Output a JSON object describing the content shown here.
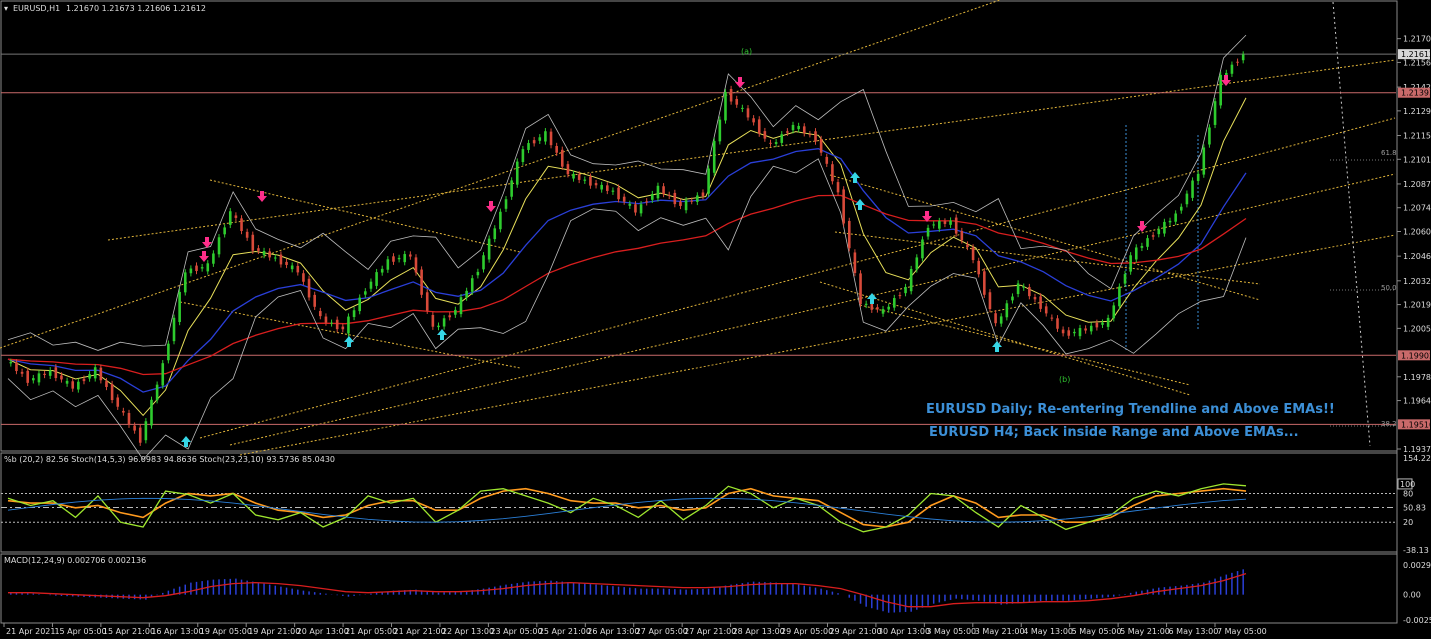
{
  "header": {
    "symbol": "EURUSD,H1",
    "ohlc": "1.21670 1.21673 1.21606 1.21612"
  },
  "annotations": {
    "daily": "EURUSD Daily; Re-entering Trendline and Above EMAs!!",
    "h4": "EURUSD H4; Back inside Range and Above EMAs...",
    "wave_a": "(a)",
    "wave_b": "(b)",
    "fib_618": "61.8",
    "fib_500": "50.0",
    "fib_382": "38.2"
  },
  "colors": {
    "background": "#000000",
    "bull_candle": "#2ecc2e",
    "bear_candle": "#d84a3a",
    "ema_fast": "#e8e05a",
    "ema_mid": "#2a3fd8",
    "ema_slow": "#d81e1e",
    "bollinger": "#bdbdbd",
    "trend_lines": "#e0b43a",
    "sell_arrow": "#ff2e8a",
    "buy_arrow": "#36d6e6",
    "stoch_fast": "#9ee62e",
    "stoch_slow": "#ff9a1e",
    "macd_hist": "#2a3fd8",
    "macd_signal": "#d81e1e",
    "annotation_text": "#3c8fd6"
  },
  "chart_data": [
    {
      "type": "line",
      "name": "price-panel",
      "y_axis_ticks": [
        "1.21700",
        "1.21565",
        "1.21425",
        "1.21290",
        "1.21150",
        "1.21015",
        "1.20875",
        "1.20740",
        "1.20605",
        "1.20465",
        "1.20325",
        "1.20190",
        "1.20055",
        "1.19780",
        "1.19645",
        "1.19370"
      ],
      "ylim": [
        1.1937,
        1.2184
      ],
      "price_labels": [
        {
          "text": "1.21612",
          "value": 1.21612
        },
        {
          "text": "1.21393",
          "value": 1.21393
        },
        {
          "text": "1.19902",
          "value": 1.19902
        },
        {
          "text": "1.19510",
          "value": 1.1951
        }
      ],
      "horizontal_levels": [
        1.21393,
        1.19902,
        1.1951
      ],
      "x_labels": [
        "21 Apr 2021",
        "15 Apr 05:00",
        "15 Apr 21:00",
        "16 Apr 13:00",
        "19 Apr 05:00",
        "19 Apr 21:00",
        "20 Apr 13:00",
        "21 Apr 05:00",
        "21 Apr 21:00",
        "22 Apr 13:00",
        "23 Apr 05:00",
        "25 Apr 21:00",
        "26 Apr 13:00",
        "27 Apr 05:00",
        "27 Apr 21:00",
        "28 Apr 13:00",
        "29 Apr 05:00",
        "29 Apr 21:00",
        "30 Apr 13:00",
        "3 May 05:00",
        "3 May 21:00",
        "4 May 13:00",
        "5 May 05:00",
        "5 May 21:00",
        "6 May 13:00",
        "7 May 05:00"
      ],
      "series": [
        {
          "name": "close",
          "values": [
            1.1988,
            1.1976,
            1.1981,
            1.1972,
            1.1982,
            1.1961,
            1.1942,
            1.1985,
            1.2038,
            1.2041,
            1.2072,
            1.2051,
            1.2045,
            1.2038,
            1.2011,
            1.2005,
            1.2028,
            1.2044,
            1.2047,
            1.2005,
            1.2016,
            1.2039,
            1.2071,
            1.2108,
            1.2116,
            1.2093,
            1.2088,
            1.2083,
            1.2072,
            1.2085,
            1.2075,
            1.2082,
            1.2139,
            1.2126,
            1.2109,
            1.2121,
            1.2113,
            1.2082,
            1.202,
            1.2015,
            1.2029,
            1.2064,
            1.2066,
            1.2045,
            1.2007,
            1.2031,
            1.2018,
            1.2002,
            1.2005,
            1.201,
            1.2047,
            1.2059,
            1.207,
            1.2094,
            1.2148,
            1.2161
          ]
        }
      ]
    },
    {
      "type": "line",
      "name": "stochastic-panel",
      "header": "%b (20,2) 82.56 Stoch(14,5,3) 96.0983 94.8636 Stoch(23,23,10) 93.5736 85.0430",
      "y_axis_ticks": [
        "154.22",
        "80",
        "50.83",
        "20",
        "-38.13"
      ],
      "ylim": [
        -38.13,
        154.22
      ],
      "value_box": "100",
      "series": [
        {
          "name": "Stoch(14,5,3)",
          "values": [
            70,
            55,
            65,
            30,
            75,
            20,
            10,
            85,
            78,
            60,
            80,
            35,
            25,
            40,
            10,
            30,
            75,
            60,
            70,
            20,
            45,
            85,
            90,
            75,
            60,
            40,
            70,
            55,
            30,
            65,
            25,
            55,
            95,
            80,
            50,
            70,
            55,
            20,
            0,
            10,
            35,
            80,
            75,
            40,
            10,
            55,
            30,
            5,
            20,
            35,
            70,
            85,
            75,
            90,
            100,
            96
          ]
        },
        {
          "name": "Stoch(23,23,10)",
          "values": [
            65,
            60,
            60,
            50,
            55,
            40,
            30,
            60,
            80,
            75,
            80,
            60,
            45,
            40,
            30,
            35,
            55,
            65,
            65,
            45,
            45,
            70,
            85,
            90,
            80,
            65,
            60,
            60,
            50,
            55,
            45,
            50,
            80,
            90,
            75,
            70,
            65,
            40,
            15,
            10,
            20,
            55,
            75,
            60,
            30,
            35,
            35,
            20,
            20,
            30,
            55,
            75,
            80,
            85,
            90,
            85
          ]
        }
      ]
    },
    {
      "type": "bar",
      "name": "macd-panel",
      "header": "MACD(12,24,9) 0.002706 0.002136",
      "y_axis_ticks": [
        "0.002955",
        "0.00",
        "-0.002524"
      ],
      "ylim": [
        -0.002524,
        0.002955
      ],
      "series": [
        {
          "name": "MACD(12,24,9)",
          "values": [
            0.0002,
            0.0001,
            -0.0001,
            -0.0002,
            -0.0003,
            -0.0004,
            -0.0005,
            0.0004,
            0.0012,
            0.0015,
            0.0016,
            0.0012,
            0.0008,
            0.0004,
            0.0001,
            -0.0002,
            0.0001,
            0.0004,
            0.0005,
            0.0002,
            0.0003,
            0.0006,
            0.001,
            0.0013,
            0.0014,
            0.0012,
            0.001,
            0.0008,
            0.0006,
            0.0006,
            0.0005,
            0.0006,
            0.001,
            0.0013,
            0.0012,
            0.001,
            0.0006,
            0.0,
            -0.0012,
            -0.0018,
            -0.0017,
            -0.0009,
            -0.0004,
            -0.0006,
            -0.001,
            -0.0008,
            -0.0006,
            -0.0006,
            -0.0004,
            -0.0002,
            0.0003,
            0.0007,
            0.0009,
            0.0012,
            0.002,
            0.0027
          ]
        },
        {
          "name": "signal",
          "values": [
            0.0002,
            0.0002,
            0.0001,
            0.0,
            -0.0001,
            -0.0002,
            -0.0003,
            -0.0001,
            0.0003,
            0.0008,
            0.0011,
            0.0012,
            0.0011,
            0.0009,
            0.0006,
            0.0003,
            0.0002,
            0.0003,
            0.0004,
            0.0003,
            0.0003,
            0.0004,
            0.0006,
            0.0009,
            0.0011,
            0.0012,
            0.0011,
            0.001,
            0.0009,
            0.0008,
            0.0007,
            0.0007,
            0.0008,
            0.001,
            0.0011,
            0.0011,
            0.0009,
            0.0006,
            0.0,
            -0.0007,
            -0.0012,
            -0.0012,
            -0.0009,
            -0.0008,
            -0.0008,
            -0.0008,
            -0.0007,
            -0.0007,
            -0.0006,
            -0.0004,
            -0.0001,
            0.0003,
            0.0006,
            0.0009,
            0.0014,
            0.0021
          ]
        }
      ]
    }
  ]
}
